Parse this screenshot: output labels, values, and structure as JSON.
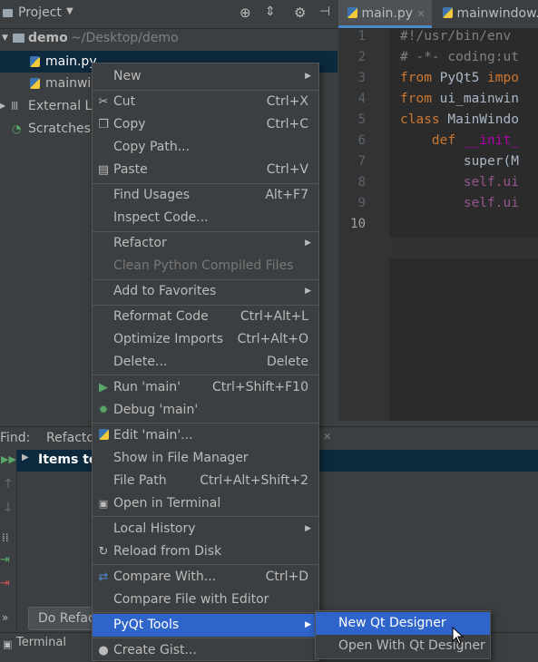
{
  "project_panel": {
    "title": "Project",
    "tree": {
      "root_name": "demo",
      "root_path": "~/Desktop/demo",
      "file_1": "main.py",
      "file_2": "mainwin",
      "external": "External Li",
      "scratches": "Scratches a"
    }
  },
  "editor": {
    "tabs": [
      "main.py",
      "mainwindow."
    ],
    "line_numbers": [
      "1",
      "2",
      "3",
      "4",
      "5",
      "6",
      "7",
      "8",
      "9",
      "10"
    ],
    "lines": [
      "#!/usr/bin/env",
      "# -*- coding:ut",
      "from PyQt5 impo",
      "from ui_mainwin",
      "class MainWindo",
      "    def __init_",
      "        super(M",
      "        self.ui",
      "        self.ui",
      ""
    ]
  },
  "find_panel": {
    "find_label": "Find:",
    "tab_label": "Refacto",
    "items_label": "Items to",
    "do_refactor_button": "Do Refac"
  },
  "bottom_bar": {
    "terminal": "Terminal"
  },
  "context_menu": {
    "new": "New",
    "cut": "Cut",
    "cut_sc": "Ctrl+X",
    "copy": "Copy",
    "copy_sc": "Ctrl+C",
    "copy_path": "Copy Path...",
    "paste": "Paste",
    "paste_sc": "Ctrl+V",
    "find_usages": "Find Usages",
    "find_usages_sc": "Alt+F7",
    "inspect_code": "Inspect Code...",
    "refactor": "Refactor",
    "clean_python": "Clean Python Compiled Files",
    "add_favorites": "Add to Favorites",
    "reformat": "Reformat Code",
    "reformat_sc": "Ctrl+Alt+L",
    "optimize": "Optimize Imports",
    "optimize_sc": "Ctrl+Alt+O",
    "delete": "Delete...",
    "delete_sc": "Delete",
    "run": "Run 'main'",
    "run_sc": "Ctrl+Shift+F10",
    "debug": "Debug 'main'",
    "edit": "Edit 'main'...",
    "show_file_manager": "Show in File Manager",
    "file_path": "File Path",
    "file_path_sc": "Ctrl+Alt+Shift+2",
    "open_terminal": "Open in Terminal",
    "local_history": "Local History",
    "reload": "Reload from Disk",
    "compare_with": "Compare With...",
    "compare_with_sc": "Ctrl+D",
    "compare_editor": "Compare File with Editor",
    "pyqt_tools": "PyQt Tools",
    "create_gist": "Create Gist..."
  },
  "submenu": {
    "new_designer": "New Qt Designer",
    "open_designer": "Open With Qt Designer"
  },
  "colors": {
    "menu_selection": "#2f65ca",
    "tree_selection": "#0d293e",
    "keyword": "#cc7832"
  }
}
